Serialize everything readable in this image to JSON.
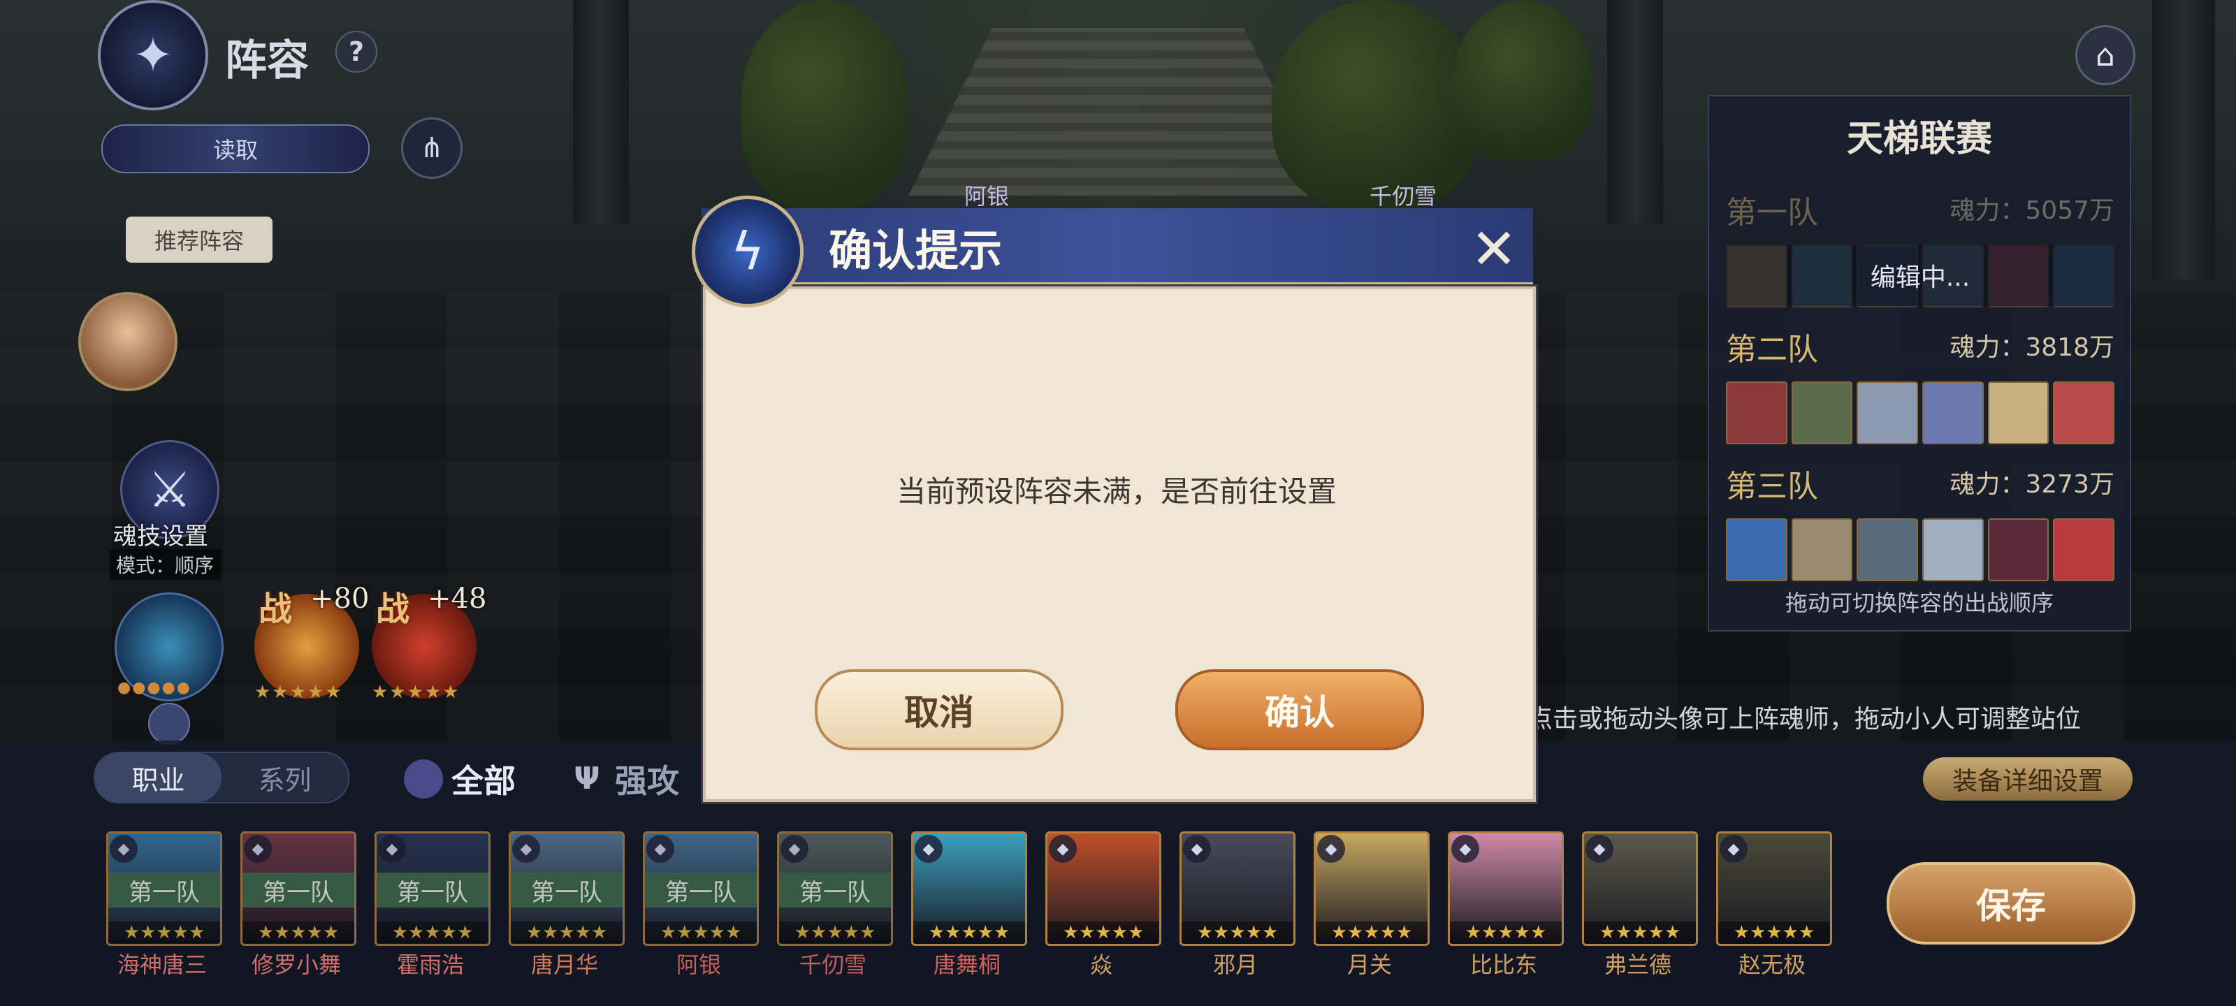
{
  "header": {
    "title": "阵容",
    "help_icon": "question-icon",
    "read_label": "读取",
    "share_icon": "share-icon",
    "recommend_label": "推荐阵容",
    "home_icon": "home-icon"
  },
  "stage": {
    "names": [
      "阿银",
      "千仞雪"
    ]
  },
  "soul_skill": {
    "label": "魂技设置",
    "mode": "模式：顺序",
    "icon": "crossed-swords-icon"
  },
  "pets": [
    {
      "tag": "战",
      "bonus": "+80",
      "stars": "★★★★★"
    },
    {
      "tag": "战",
      "bonus": "+48",
      "stars": "★★★★★"
    }
  ],
  "ladder": {
    "title": "天梯联赛",
    "editing": "编辑中...",
    "teams": [
      {
        "name": "第一队",
        "power": "魂力：5057万"
      },
      {
        "name": "第二队",
        "power": "魂力：3818万"
      },
      {
        "name": "第三队",
        "power": "魂力：3273万"
      }
    ],
    "hint": "拖动可切换阵容的出战顺序"
  },
  "bottom": {
    "drag_hint": "点击或拖动头像可上阵魂师，拖动小人可调整站位",
    "tabs": [
      "职业",
      "系列"
    ],
    "filters": [
      "全部",
      "强攻"
    ],
    "equip_label": "装备详细设置",
    "save_label": "保存",
    "heroes": [
      {
        "name": "海神唐三",
        "team": "第一队"
      },
      {
        "name": "修罗小舞",
        "team": "第一队"
      },
      {
        "name": "霍雨浩",
        "team": "第一队"
      },
      {
        "name": "唐月华",
        "team": "第一队"
      },
      {
        "name": "阿银",
        "team": "第一队"
      },
      {
        "name": "千仞雪",
        "team": "第一队"
      },
      {
        "name": "唐舞桐",
        "team": ""
      },
      {
        "name": "焱",
        "team": ""
      },
      {
        "name": "邪月",
        "team": ""
      },
      {
        "name": "月关",
        "team": ""
      },
      {
        "name": "比比东",
        "team": ""
      },
      {
        "name": "弗兰德",
        "team": ""
      },
      {
        "name": "赵无极",
        "team": ""
      }
    ]
  },
  "dialog": {
    "title": "确认提示",
    "message": "当前预设阵容未满，是否前往设置",
    "cancel_label": "取消",
    "confirm_label": "确认",
    "close_icon": "close-icon"
  },
  "colors": {
    "accent_orange": "#d98a45",
    "team_tag_green": "#3f6b4c",
    "gold": "#d8b774",
    "dialog_header": "#3e5199"
  }
}
